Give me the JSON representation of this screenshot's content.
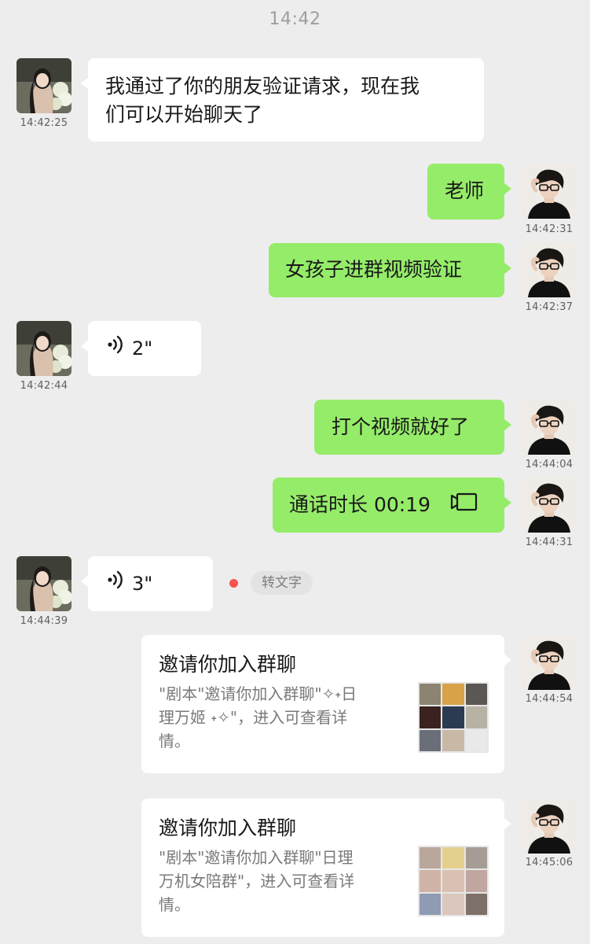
{
  "header": {
    "time": "14:42"
  },
  "messages": {
    "m1": {
      "text": "我通过了你的朋友验证请求，现在我们可以开始聊天了",
      "line1": "我通过了你的朋友验证请求，现在我",
      "line2": "们可以开始聊天了",
      "stamp": "14:42:25"
    },
    "m2": {
      "text": "老师",
      "stamp": "14:42:31"
    },
    "m3": {
      "text": "女孩子进群视频验证",
      "stamp": "14:42:37"
    },
    "m4": {
      "duration": "2\"",
      "stamp": "14:42:44"
    },
    "m5": {
      "text": "打个视频就好了",
      "stamp": "14:44:04"
    },
    "m6": {
      "text": "通话时长 00:19",
      "stamp": "14:44:31",
      "icon": "video-call-icon"
    },
    "m7": {
      "duration": "3\"",
      "stamp": "14:44:39",
      "to_text_label": "转文字",
      "unread_color": "#fa5151"
    },
    "m8": {
      "title": "邀请你加入群聊",
      "desc_line1": "\"剧本\"邀请你加入群聊\"✧˖日",
      "desc_line2": "理万姬 ˖✧\"，进入可查看详",
      "desc_line3": "情。",
      "stamp": "14:44:54"
    },
    "m9": {
      "title": "邀请你加入群聊",
      "desc_line1": "\"剧本\"邀请你加入群聊\"日理",
      "desc_line2": "万机女陪群\"，进入可查看详",
      "desc_line3": "情。",
      "stamp": "14:45:06"
    }
  },
  "colors": {
    "background": "#ededed",
    "sent_bubble": "#95ec69",
    "received_bubble": "#ffffff",
    "timestamp": "#5f5f5f"
  }
}
